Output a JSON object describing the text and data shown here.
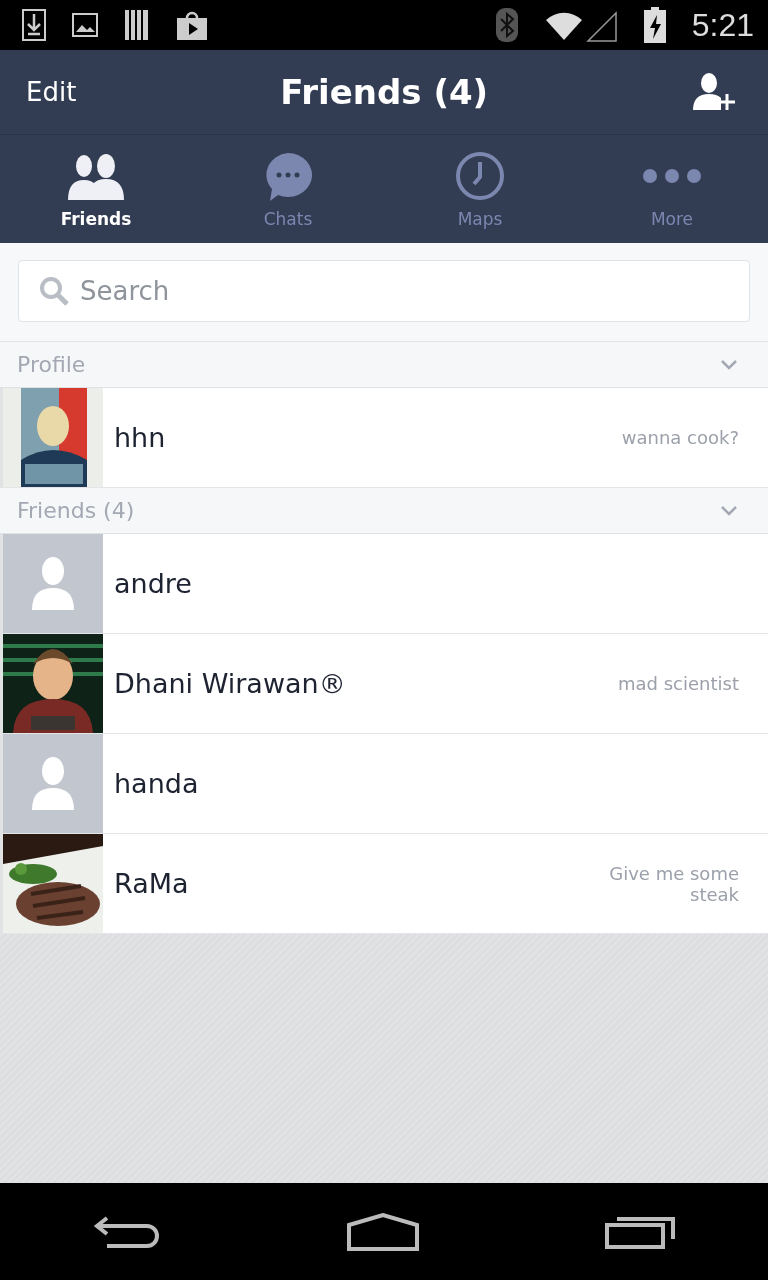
{
  "status_bar": {
    "time": "5:21"
  },
  "header": {
    "left_action": "Edit",
    "title": "Friends (4)"
  },
  "tabs": [
    {
      "label": "Friends",
      "selected": true,
      "kind": "friends"
    },
    {
      "label": "Chats",
      "selected": false,
      "kind": "chats"
    },
    {
      "label": "Maps",
      "selected": false,
      "kind": "clock"
    },
    {
      "label": "More",
      "selected": false,
      "kind": "more"
    }
  ],
  "search": {
    "placeholder": "Search"
  },
  "sections": [
    {
      "title": "Profile",
      "expanded": true,
      "rows": [
        {
          "name": "hhn",
          "status": "wanna cook?"
        }
      ]
    },
    {
      "title": "Friends (4)",
      "expanded": true,
      "rows": [
        {
          "name": "andre",
          "avatar": {
            "kind": "placeholder"
          }
        },
        {
          "name": "Dhani Wirawan®",
          "status": "mad scientist"
        },
        {
          "name": "handa",
          "avatar": {
            "kind": "placeholder"
          }
        },
        {
          "name": "RaMa",
          "status": "Give me some steak"
        }
      ]
    }
  ]
}
